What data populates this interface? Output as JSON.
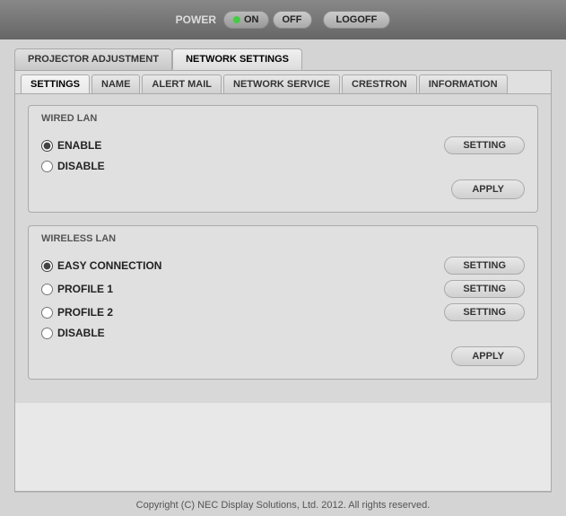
{
  "powerBar": {
    "powerLabel": "POWER",
    "onLabel": "ON",
    "offLabel": "OFF",
    "logoffLabel": "LOGOFF"
  },
  "topTabs": [
    {
      "id": "projector",
      "label": "PROJECTOR ADJUSTMENT",
      "active": false
    },
    {
      "id": "network",
      "label": "NETWORK SETTINGS",
      "active": true
    }
  ],
  "subTabs": [
    {
      "id": "settings",
      "label": "SETTINGS",
      "active": true
    },
    {
      "id": "name",
      "label": "NAME",
      "active": false
    },
    {
      "id": "alertmail",
      "label": "ALERT MAIL",
      "active": false
    },
    {
      "id": "networkservice",
      "label": "NETWORK SERVICE",
      "active": false
    },
    {
      "id": "crestron",
      "label": "CRESTRON",
      "active": false
    },
    {
      "id": "information",
      "label": "INFORMATION",
      "active": false
    }
  ],
  "wiredLan": {
    "title": "WIRED LAN",
    "enableLabel": "ENABLE",
    "disableLabel": "DISABLE",
    "settingLabel": "SETTING",
    "applyLabel": "APPLY"
  },
  "wirelessLan": {
    "title": "WIRELESS LAN",
    "easyConnectionLabel": "EASY CONNECTION",
    "profile1Label": "PROFILE 1",
    "profile2Label": "PROFILE 2",
    "disableLabel": "DISABLE",
    "settingLabel": "SETTING",
    "applyLabel": "APPLY"
  },
  "footer": {
    "text": "Copyright (C) NEC Display Solutions, Ltd. 2012. All rights reserved."
  }
}
